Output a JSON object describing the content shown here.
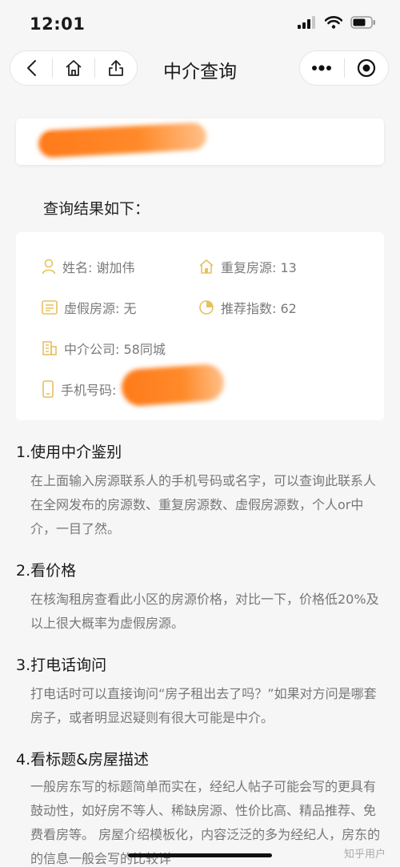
{
  "status": {
    "time": "12:01"
  },
  "nav": {
    "title": "中介查询"
  },
  "search": {
    "placeholder": ""
  },
  "results": {
    "title": "查询结果如下：",
    "name": "姓名: 谢加伟",
    "duplicate": "重复房源: 13",
    "fake": "虚假房源: 无",
    "score": "推荐指数: 62",
    "company": "中介公司: 58同城",
    "phone": "手机号码:"
  },
  "tips": [
    {
      "heading": "1.使用中介鉴别",
      "body": "在上面输入房源联系人的手机号码或名字，可以查询此联系人在全网发布的房源数、重复房源数、虚假房源数，个人or中介，一目了然。"
    },
    {
      "heading": "2.看价格",
      "body": "在核淘租房查看此小区的房源价格，对比一下，价格低20%及以上很大概率为虚假房源。"
    },
    {
      "heading": "3.打电话询问",
      "body": "打电话时可以直接询问“房子租出去了吗？”如果对方问是哪套房子，或者明显迟疑则有很大可能是中介。"
    },
    {
      "heading": "4.看标题&房屋描述",
      "body": "一般房东写的标题简单而实在，经纪人帖子可能会写的更具有鼓动性，如好房不等人、稀缺房源、性价比高、精品推荐、免费看房等。 房屋介绍模板化，内容泛泛的多为经纪人，房东的的信息一般会写的比较详"
    }
  ],
  "watermark": "知乎用户",
  "colors": {
    "accent": "#f0c040",
    "redaction": "#ff7a1a"
  }
}
